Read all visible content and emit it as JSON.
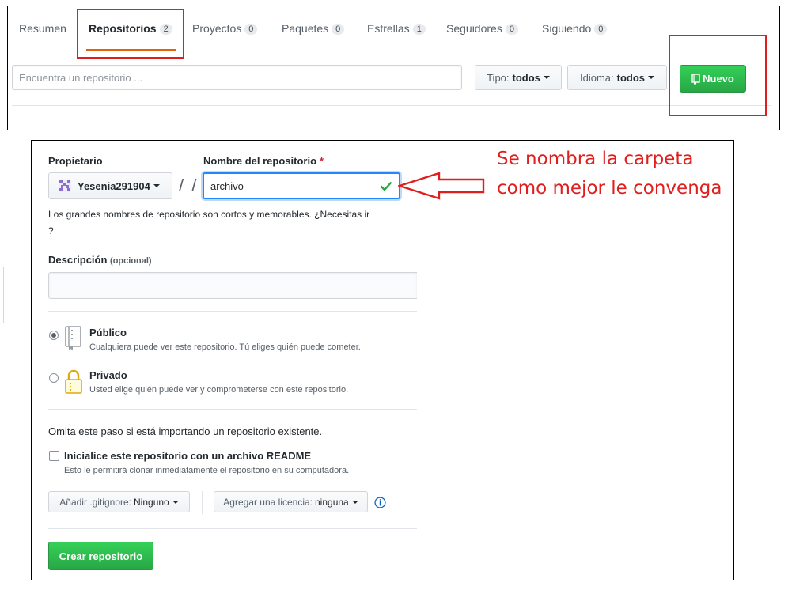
{
  "tabs": [
    {
      "label": "Resumen",
      "count": null
    },
    {
      "label": "Repositorios",
      "count": "2"
    },
    {
      "label": "Proyectos",
      "count": "0"
    },
    {
      "label": "Paquetes",
      "count": "0"
    },
    {
      "label": "Estrellas",
      "count": "1"
    },
    {
      "label": "Seguidores",
      "count": "0"
    },
    {
      "label": "Siguiendo",
      "count": "0"
    }
  ],
  "filter": {
    "search_placeholder": "Encuentra un repositorio ...",
    "type_label": "Tipo:",
    "type_value": "todos",
    "language_label": "Idioma:",
    "language_value": "todos",
    "new_button": "Nuevo"
  },
  "form": {
    "owner_label": "Propietario",
    "owner_value": "Yesenia291904",
    "name_label": "Nombre del repositorio",
    "required_mark": "*",
    "separator": "/ /",
    "name_value": "archivo",
    "hint_line1": "Los grandes nombres de repositorio son cortos y memorables. ¿Necesitas ir",
    "hint_line2": "?",
    "description_label": "Descripción",
    "description_optional": "(opcional)",
    "description_value": "",
    "public_title": "Público",
    "public_note": "Cualquiera puede ver este repositorio. Tú eliges quién puede cometer.",
    "private_title": "Privado",
    "private_note": "Usted elige quién puede ver y comprometerse con este repositorio.",
    "skip_note": "Omita este paso si está importando un repositorio existente.",
    "readme_label": "Inicialice este repositorio con un archivo README",
    "readme_note": "Esto le permitirá clonar inmediatamente el repositorio en su computadora.",
    "gitignore_label": "Añadir .gitignore:",
    "gitignore_value": "Ninguno",
    "license_label": "Agregar una licencia:",
    "license_value": "ninguna",
    "create_button": "Crear repositorio"
  },
  "annotation": {
    "line1": "Se nombra la carpeta",
    "line2": "como mejor le convenga",
    "color": "#e01e1e"
  },
  "colors": {
    "accent_green": "#2ea44f",
    "focus_blue": "#2188ff",
    "tab_underline": "#e36209"
  }
}
